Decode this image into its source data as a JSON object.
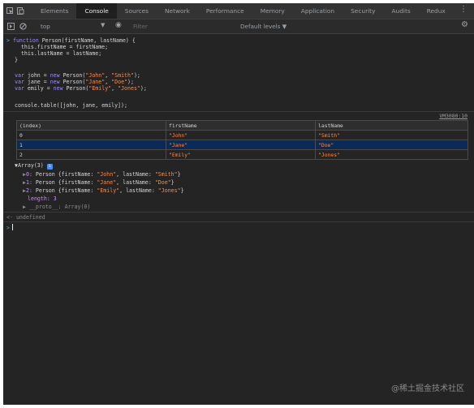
{
  "tabs": [
    {
      "label": "Elements",
      "active": false
    },
    {
      "label": "Console",
      "active": true
    },
    {
      "label": "Sources",
      "active": false
    },
    {
      "label": "Network",
      "active": false
    },
    {
      "label": "Performance",
      "active": false
    },
    {
      "label": "Memory",
      "active": false
    },
    {
      "label": "Application",
      "active": false
    },
    {
      "label": "Security",
      "active": false
    },
    {
      "label": "Audits",
      "active": false
    },
    {
      "label": "Redux",
      "active": false
    }
  ],
  "toolbar": {
    "context": "top",
    "filter_placeholder": "Filter",
    "levels": "Default levels ▼"
  },
  "code": {
    "l1": {
      "prompt": ">",
      "kw": "function",
      "rest": " Person(firstName, lastName) {"
    },
    "l2": "  this.firstName = firstName;",
    "l3": "  this.lastName = lastName;",
    "l4": "}",
    "l5": {
      "kw": "var",
      "pre": " john = ",
      "kw2": "new",
      "mid": " Person(",
      "a": "\"John\"",
      "sep": ", ",
      "b": "\"Smith\"",
      "end": ");"
    },
    "l6": {
      "kw": "var",
      "pre": " jane = ",
      "kw2": "new",
      "mid": " Person(",
      "a": "\"Jane\"",
      "sep": ", ",
      "b": "\"Doe\"",
      "end": ");"
    },
    "l7": {
      "kw": "var",
      "pre": " emily = ",
      "kw2": "new",
      "mid": " Person(",
      "a": "\"Emily\"",
      "sep": ", ",
      "b": "\"Jones\"",
      "end": ");"
    },
    "l8": "console.table([john, jane, emily]);"
  },
  "source_ref": "VM3080:10",
  "table": {
    "headers": [
      "(index)",
      "firstName",
      "lastName"
    ],
    "rows": [
      [
        "0",
        "\"John\"",
        "\"Smith\""
      ],
      [
        "1",
        "\"Jane\"",
        "\"Doe\""
      ],
      [
        "2",
        "\"Emily\"",
        "\"Jones\""
      ]
    ],
    "selected_row": 1
  },
  "array": {
    "header": "▼Array(3)",
    "info_badge": "i",
    "items": [
      {
        "arrow": "▶",
        "idx": "0:",
        "name": " Person {firstName: ",
        "first": "\"John\"",
        "mid": ", lastName: ",
        "last": "\"Smith\"",
        "end": "}"
      },
      {
        "arrow": "▶",
        "idx": "1:",
        "name": " Person {firstName: ",
        "first": "\"Jane\"",
        "mid": ", lastName: ",
        "last": "\"Doe\"",
        "end": "}"
      },
      {
        "arrow": "▶",
        "idx": "2:",
        "name": " Person {firstName: ",
        "first": "\"Emily\"",
        "mid": ", lastName: ",
        "last": "\"Jones\"",
        "end": "}"
      }
    ],
    "length": "length: 3",
    "proto": "▶ __proto__: Array(0)"
  },
  "result": {
    "arrow": "<·",
    "value": "undefined"
  },
  "input_prompt": ">",
  "watermark": "@稀土掘金技术社区",
  "colors": {
    "panel": "#242424",
    "keyword": "#9e8cf5",
    "string": "#f28b54",
    "selected_row": "#0a2a57"
  }
}
